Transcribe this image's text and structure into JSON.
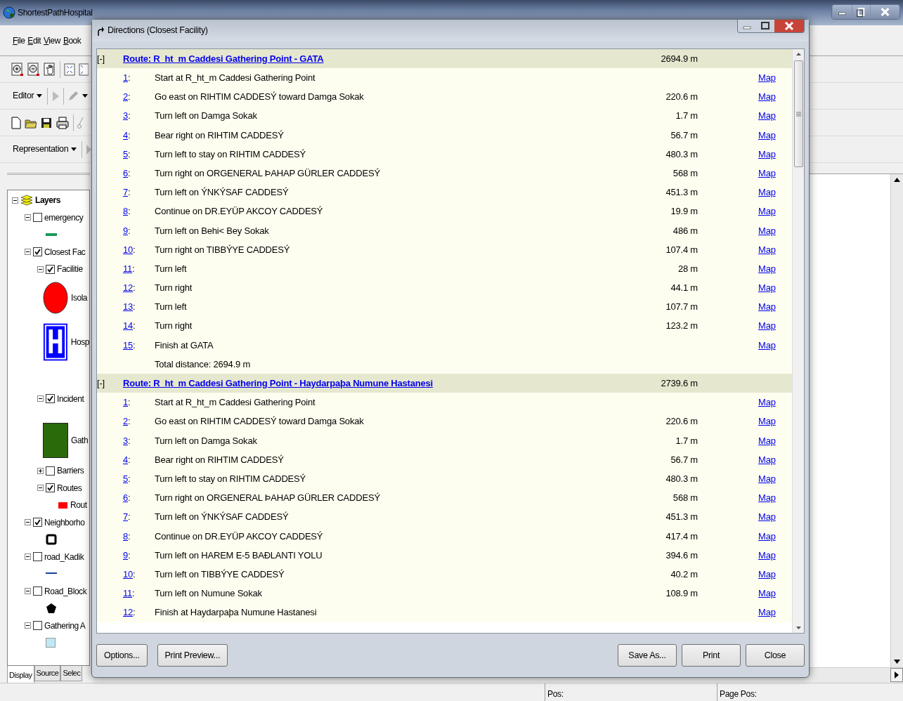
{
  "app": {
    "title": "ShortestPathHospital",
    "menu": [
      {
        "label": "File"
      },
      {
        "label": "Edit"
      },
      {
        "label": "View"
      },
      {
        "label": "Book"
      }
    ],
    "editor_menu": {
      "label": "Editor"
    },
    "representation_menu": {
      "label": "Representation"
    }
  },
  "toc": {
    "root": {
      "label": "Layers",
      "expanded": true
    },
    "layers": [
      {
        "label": "emergency",
        "checked": false,
        "expanded": true,
        "legend": [
          {
            "kind": "line",
            "color": "#1a9a5a"
          }
        ]
      },
      {
        "label": "Closest Fac",
        "checked": true,
        "expanded": true,
        "children": [
          {
            "label": "Facilitie",
            "checked": true,
            "expanded": true,
            "legend": [
              {
                "kind": "circle",
                "color": "#ff0000",
                "label": "Isola"
              },
              {
                "kind": "hospital",
                "color": "#0000ff",
                "label": "Hosp"
              }
            ]
          },
          {
            "label": "Incident",
            "checked": true,
            "expanded": true,
            "legend": [
              {
                "kind": "square",
                "color": "#2a6a0a",
                "label": "Gath"
              }
            ]
          },
          {
            "label": "Barriers",
            "checked": false,
            "expanded": false
          },
          {
            "label": "Routes",
            "checked": true,
            "expanded": true,
            "legend": [
              {
                "kind": "rect",
                "color": "#ff0000",
                "label": "Rout"
              }
            ]
          }
        ]
      },
      {
        "label": "Neighborho",
        "checked": true,
        "expanded": true,
        "legend": [
          {
            "kind": "outline",
            "color": "#000000"
          }
        ]
      },
      {
        "label": "road_Kadik",
        "checked": false,
        "expanded": true,
        "legend": [
          {
            "kind": "line",
            "color": "#1c3f9a"
          }
        ]
      },
      {
        "label": "Road_Block",
        "checked": false,
        "expanded": true,
        "legend": [
          {
            "kind": "pentagon",
            "color": "#000000"
          }
        ]
      },
      {
        "label": "Gathering A",
        "checked": false,
        "expanded": true,
        "legend": [
          {
            "kind": "fill",
            "color": "#bfe8f5"
          }
        ]
      }
    ],
    "tabs": [
      {
        "label": "Display",
        "selected": true
      },
      {
        "label": "Source",
        "selected": false
      },
      {
        "label": "Selec",
        "selected": false
      }
    ]
  },
  "dialog": {
    "title": "Directions (Closest Facility)",
    "routes": [
      {
        "toggle": "[-]",
        "title": "Route: R_ht_m Caddesi Gathering Point - GATA",
        "distance": "2694.9 m",
        "steps": [
          {
            "num": "1",
            "suffix": ":",
            "text": "Start at R_ht_m Caddesi Gathering Point",
            "map": "Map"
          },
          {
            "num": "2",
            "suffix": ":",
            "text": "Go east on RIHTIM CADDESÝ toward Damga Sokak",
            "distance": "220.6 m",
            "map": "Map"
          },
          {
            "num": "3",
            "suffix": ":",
            "text": "Turn left on Damga Sokak",
            "distance": "1.7 m",
            "map": "Map"
          },
          {
            "num": "4",
            "suffix": ":",
            "text": "Bear right on RIHTIM CADDESÝ",
            "distance": "56.7 m",
            "map": "Map"
          },
          {
            "num": "5",
            "suffix": ":",
            "text": "Turn left to stay on RIHTIM CADDESÝ",
            "distance": "480.3 m",
            "map": "Map"
          },
          {
            "num": "6",
            "suffix": ":",
            "text": "Turn right on ORGENERAL ÞAHAP GÜRLER CADDESÝ",
            "distance": "568 m",
            "map": "Map"
          },
          {
            "num": "7",
            "suffix": ":",
            "text": "Turn left on ÝNKÝSAF CADDESÝ",
            "distance": "451.3 m",
            "map": "Map"
          },
          {
            "num": "8",
            "suffix": ":",
            "text": "Continue on DR.EYÜP AKCOY CADDESÝ",
            "distance": "19.9 m",
            "map": "Map"
          },
          {
            "num": "9",
            "suffix": ":",
            "text": "Turn left on Behi< Bey Sokak",
            "distance": "486 m",
            "map": "Map"
          },
          {
            "num": "10",
            "suffix": ":",
            "text": "Turn right on TIBBÝYE CADDESÝ",
            "distance": "107.4 m",
            "map": "Map"
          },
          {
            "num": "11",
            "suffix": ":",
            "text": "Turn left",
            "distance": "28 m",
            "map": "Map"
          },
          {
            "num": "12",
            "suffix": ":",
            "text": "Turn right",
            "distance": "44.1 m",
            "map": "Map"
          },
          {
            "num": "13",
            "suffix": ":",
            "text": "Turn left",
            "distance": "107.7 m",
            "map": "Map"
          },
          {
            "num": "14",
            "suffix": ":",
            "text": "Turn right",
            "distance": "123.2 m",
            "map": "Map"
          },
          {
            "num": "15",
            "suffix": ":",
            "text": "Finish at GATA",
            "map": "Map"
          }
        ],
        "total": "Total distance: 2694.9 m"
      },
      {
        "toggle": "[-]",
        "title": "Route: R_ht_m Caddesi Gathering Point - Haydarpaþa Numune Hastanesi",
        "distance": "2739.6 m",
        "steps": [
          {
            "num": "1",
            "suffix": ":",
            "text": "Start at R_ht_m Caddesi Gathering Point",
            "map": "Map"
          },
          {
            "num": "2",
            "suffix": ":",
            "text": "Go east on RIHTIM CADDESÝ toward Damga Sokak",
            "distance": "220.6 m",
            "map": "Map"
          },
          {
            "num": "3",
            "suffix": ":",
            "text": "Turn left on Damga Sokak",
            "distance": "1.7 m",
            "map": "Map"
          },
          {
            "num": "4",
            "suffix": ":",
            "text": "Bear right on RIHTIM CADDESÝ",
            "distance": "56.7 m",
            "map": "Map"
          },
          {
            "num": "5",
            "suffix": ":",
            "text": "Turn left to stay on RIHTIM CADDESÝ",
            "distance": "480.3 m",
            "map": "Map"
          },
          {
            "num": "6",
            "suffix": ":",
            "text": "Turn right on ORGENERAL ÞAHAP GÜRLER CADDESÝ",
            "distance": "568 m",
            "map": "Map"
          },
          {
            "num": "7",
            "suffix": ":",
            "text": "Turn left on ÝNKÝSAF CADDESÝ",
            "distance": "451.3 m",
            "map": "Map"
          },
          {
            "num": "8",
            "suffix": ":",
            "text": "Continue on DR.EYÜP AKCOY CADDESÝ",
            "distance": "417.4 m",
            "map": "Map"
          },
          {
            "num": "9",
            "suffix": ":",
            "text": "Turn left on HAREM E-5 BAÐLANTI YOLU",
            "distance": "394.6 m",
            "map": "Map"
          },
          {
            "num": "10",
            "suffix": ":",
            "text": "Turn left on TIBBÝYE CADDESÝ",
            "distance": "40.2 m",
            "map": "Map"
          },
          {
            "num": "11",
            "suffix": ":",
            "text": "Turn left on Numune Sokak",
            "distance": "108.9 m",
            "map": "Map"
          },
          {
            "num": "12",
            "suffix": ":",
            "text": "Finish at Haydarpaþa Numune Hastanesi",
            "map": "Map"
          }
        ]
      }
    ],
    "buttons_left": [
      "Options...",
      "Print Preview..."
    ],
    "buttons_right": [
      "Save As...",
      "Print",
      "Close"
    ]
  },
  "status_bar": {
    "pos": "Pos:",
    "page_pos": "Page Pos:"
  }
}
